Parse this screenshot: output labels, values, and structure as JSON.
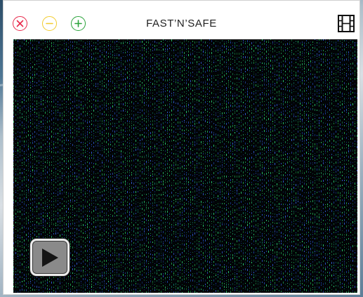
{
  "window": {
    "title": "FAST’N’SAFE"
  },
  "controls": {
    "close_icon": "close-icon",
    "minimize_icon": "minimize-icon",
    "maximize_icon": "maximize-icon",
    "film_icon": "film-icon",
    "close_color": "#e8284a",
    "minimize_color": "#f2cc2e",
    "maximize_color": "#2aa33a"
  },
  "video": {
    "play_icon": "play-icon",
    "noise_colors": [
      "#1e9b4a",
      "#27c06a",
      "#1a3f9a",
      "#2f58c8",
      "#0f6f5a"
    ]
  }
}
